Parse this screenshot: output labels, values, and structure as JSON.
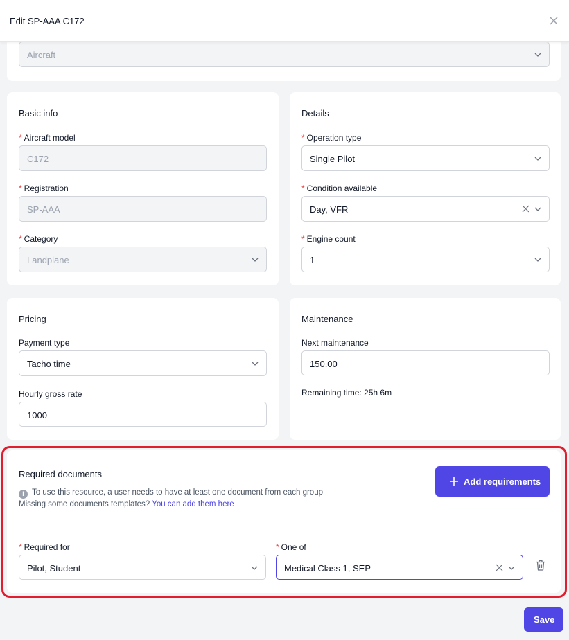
{
  "header": {
    "title": "Edit SP-AAA C172"
  },
  "top_card": {
    "select_value": "Aircraft"
  },
  "basic_info": {
    "title": "Basic info",
    "aircraft_model_label": "Aircraft model",
    "aircraft_model_value": "C172",
    "registration_label": "Registration",
    "registration_value": "SP-AAA",
    "category_label": "Category",
    "category_value": "Landplane"
  },
  "details": {
    "title": "Details",
    "operation_type_label": "Operation type",
    "operation_type_value": "Single Pilot",
    "condition_label": "Condition available",
    "condition_value": "Day, VFR",
    "engine_count_label": "Engine count",
    "engine_count_value": "1"
  },
  "pricing": {
    "title": "Pricing",
    "payment_type_label": "Payment type",
    "payment_type_value": "Tacho time",
    "hourly_rate_label": "Hourly gross rate",
    "hourly_rate_value": "1000"
  },
  "maintenance": {
    "title": "Maintenance",
    "next_label": "Next maintenance",
    "next_value": "150.00",
    "remaining": "Remaining time: 25h 6m"
  },
  "required_documents": {
    "title": "Required documents",
    "info": "To use this resource, a user needs to have at least one document from each group",
    "missing_text": "Missing some documents templates?",
    "missing_link": "You can add them here",
    "add_button": "Add requirements",
    "required_for_label": "Required for",
    "required_for_value": "Pilot, Student",
    "one_of_label": "One of",
    "one_of_value": "Medical Class 1, SEP"
  },
  "footer": {
    "save_label": "Save"
  },
  "colors": {
    "accent": "#4f46e5",
    "required_star": "#ef4444",
    "highlight": "#e11d2e"
  }
}
